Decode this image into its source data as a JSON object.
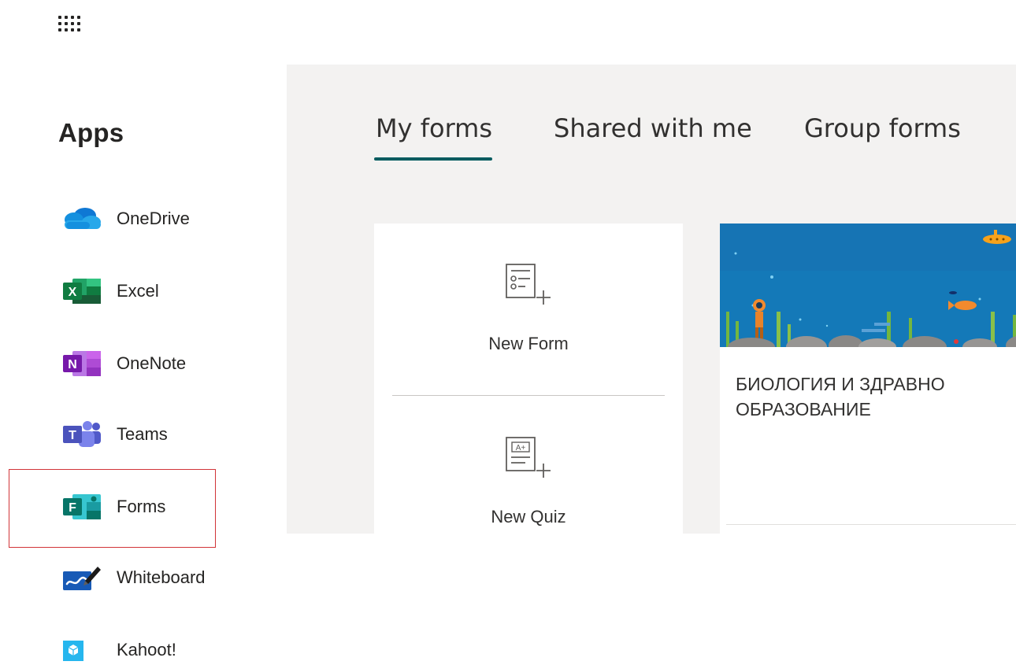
{
  "sidebar": {
    "title": "Apps",
    "items": [
      {
        "label": "OneDrive",
        "icon": "onedrive-icon"
      },
      {
        "label": "Excel",
        "icon": "excel-icon",
        "icon_letter": "X"
      },
      {
        "label": "OneNote",
        "icon": "onenote-icon",
        "icon_letter": "N"
      },
      {
        "label": "Teams",
        "icon": "teams-icon",
        "icon_letter": "T"
      },
      {
        "label": "Forms",
        "icon": "forms-icon",
        "icon_letter": "F"
      },
      {
        "label": "Whiteboard",
        "icon": "whiteboard-icon"
      },
      {
        "label": "Kahoot!",
        "icon": "kahoot-icon"
      }
    ]
  },
  "forms": {
    "tabs": [
      {
        "label": "My forms",
        "selected": true
      },
      {
        "label": "Shared with me",
        "selected": false
      },
      {
        "label": "Group forms",
        "selected": false
      }
    ],
    "new_form_label": "New Form",
    "new_quiz_label": "New Quiz",
    "cards": [
      {
        "title": "БИОЛОГИЯ И ЗДРАВНО ОБРАЗОВАНИЕ"
      }
    ]
  },
  "colors": {
    "accent": "#035b5f",
    "highlight": "#d13438",
    "panel_bg": "#f3f2f1",
    "excel": "#107c41",
    "onenote": "#7719aa",
    "teams": "#5059c9",
    "forms": "#077568",
    "kahoot": "#26b6ee",
    "onedrive": "#0364b8"
  }
}
